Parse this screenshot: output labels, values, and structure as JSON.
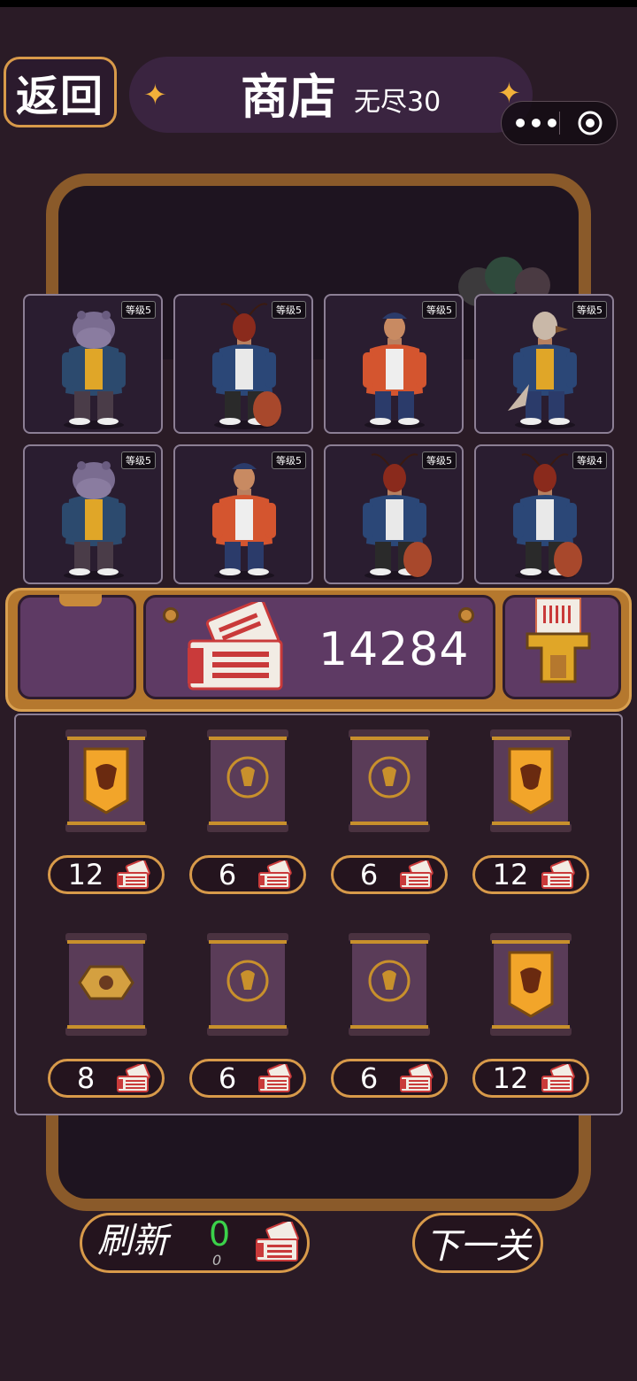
{
  "header": {
    "back_label": "返回",
    "title": "商店",
    "subtitle": "无尽30"
  },
  "capsule": {
    "more_icon": "more-dots-icon",
    "close_icon": "target-close-icon"
  },
  "characters": [
    {
      "level_label": "等级5",
      "species": "hippo",
      "jacket": "#2c4a6e",
      "shirt": "#e0a628",
      "pants": "#4a3c48"
    },
    {
      "level_label": "等级5",
      "species": "ant",
      "jacket": "#2b4777",
      "shirt": "#e9e9e9",
      "pants": "#2a2a2a"
    },
    {
      "level_label": "等级5",
      "species": "human",
      "jacket": "#d4552f",
      "shirt": "#eeeeee",
      "pants": "#2b3b6a"
    },
    {
      "level_label": "等级5",
      "species": "bird",
      "jacket": "#2b4777",
      "shirt": "#e0a628",
      "pants": "#2b3b6a"
    },
    {
      "level_label": "等级5",
      "species": "hippo",
      "jacket": "#2c4a6e",
      "shirt": "#e0a628",
      "pants": "#4a3c48"
    },
    {
      "level_label": "等级5",
      "species": "human",
      "jacket": "#d4552f",
      "shirt": "#eeeeee",
      "pants": "#2b3b6a"
    },
    {
      "level_label": "等级5",
      "species": "ant",
      "jacket": "#2b4777",
      "shirt": "#e9e9e9",
      "pants": "#2a2a2a"
    },
    {
      "level_label": "等级4",
      "species": "ant",
      "jacket": "#2b4777",
      "shirt": "#e9e9e9",
      "pants": "#2a2a2a"
    }
  ],
  "tickets": {
    "value": "14284",
    "icon": "ticket-icon",
    "stamp_icon": "ticket-stamp-icon"
  },
  "shop_items": [
    {
      "price": "12",
      "style": "gold-shield"
    },
    {
      "price": "6",
      "style": "purple-emblem"
    },
    {
      "price": "6",
      "style": "purple-emblem"
    },
    {
      "price": "12",
      "style": "gold-shield"
    },
    {
      "price": "8",
      "style": "purple-badge"
    },
    {
      "price": "6",
      "style": "purple-emblem"
    },
    {
      "price": "6",
      "style": "purple-emblem"
    },
    {
      "price": "12",
      "style": "gold-shield"
    }
  ],
  "refresh": {
    "label": "刷新",
    "count": "0",
    "sub": "0"
  },
  "next_label": "下一关",
  "colors": {
    "accent": "#d89a4a",
    "bg": "#2a1b26",
    "panel": "#5e3a64",
    "green": "#3bd14a"
  }
}
